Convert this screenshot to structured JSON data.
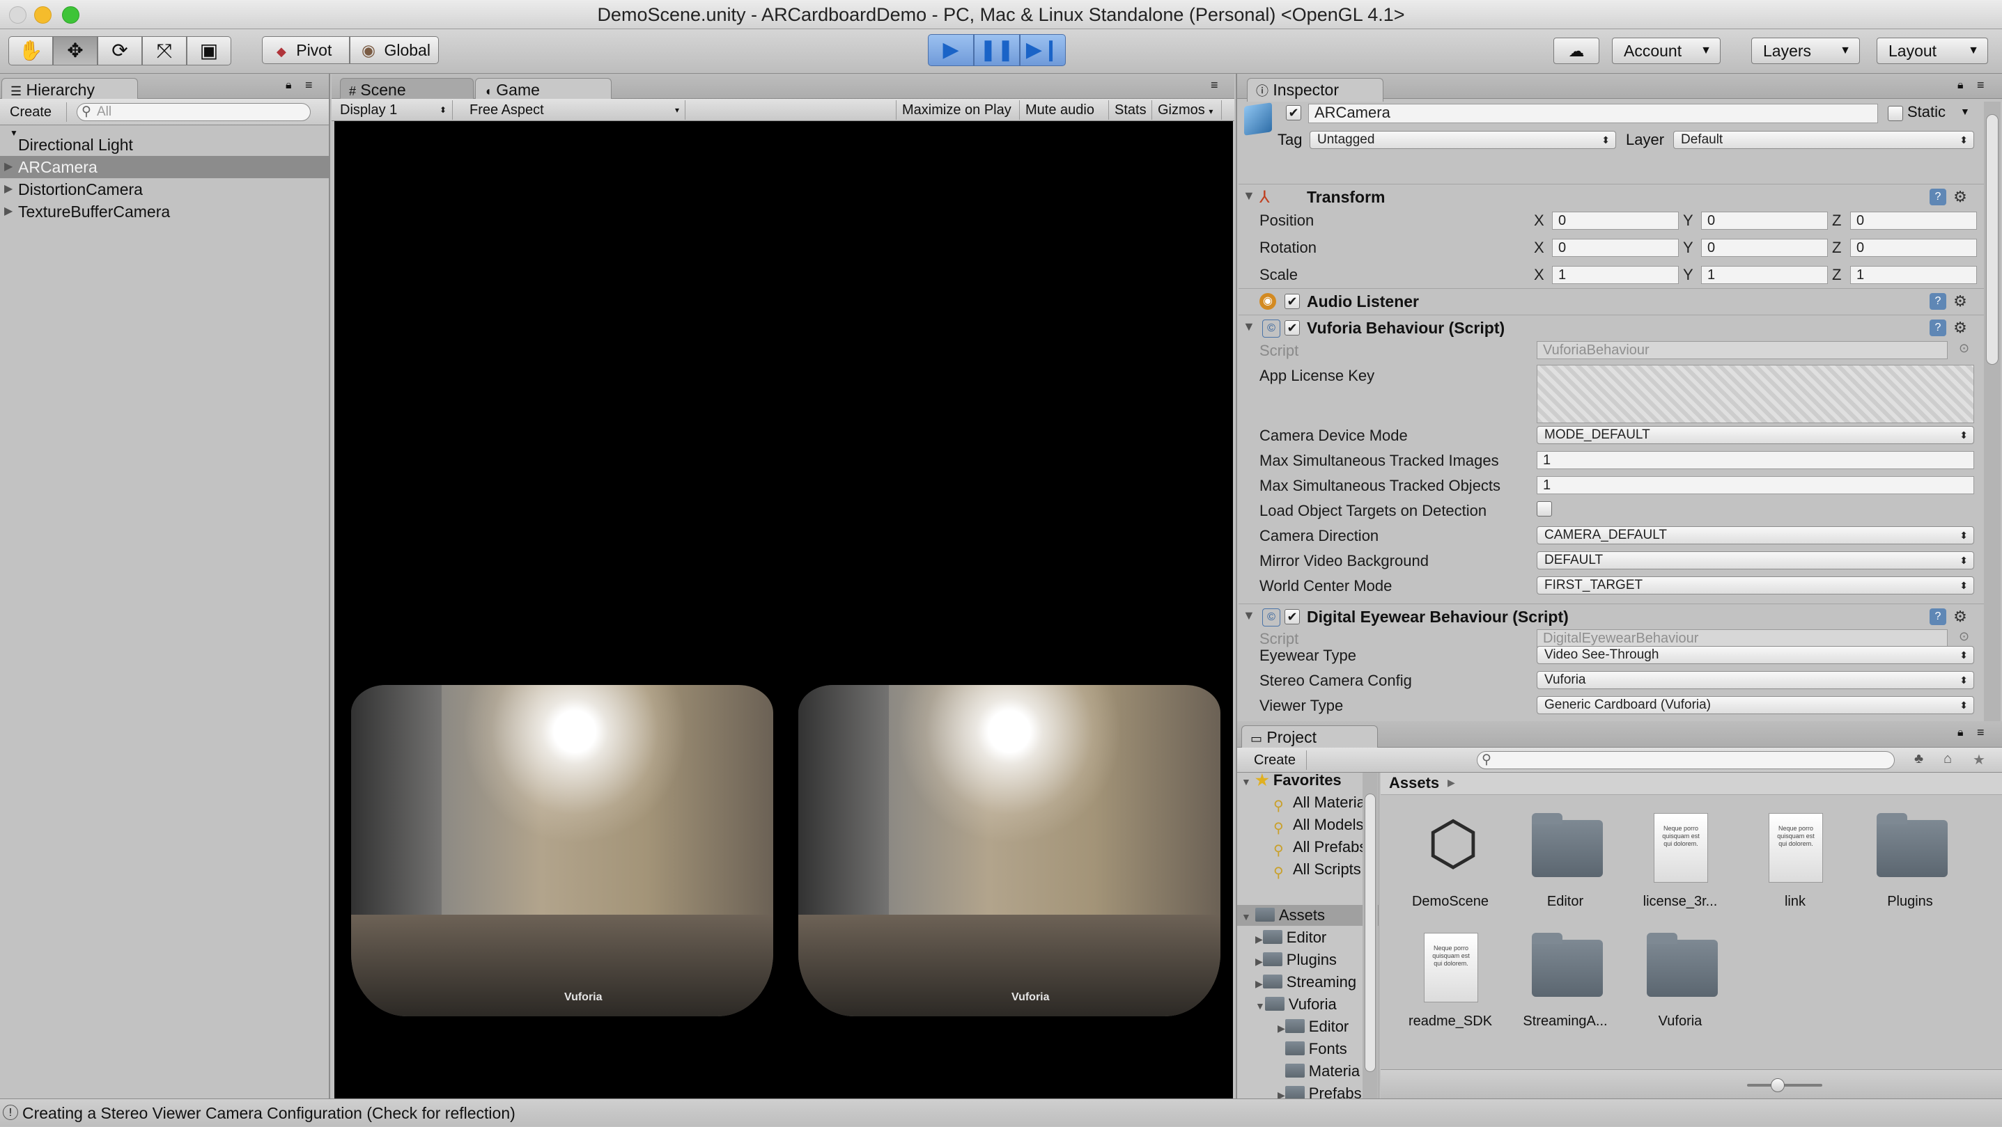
{
  "window": {
    "title": "DemoScene.unity - ARCardboardDemo - PC, Mac & Linux Standalone (Personal) <OpenGL 4.1>"
  },
  "toolbar": {
    "tools": [
      "hand-icon",
      "move-icon",
      "rotate-icon",
      "scale-icon",
      "rect-tool-icon"
    ],
    "pivot_label": "Pivot",
    "global_label": "Global",
    "account_label": "Account",
    "layers_label": "Layers",
    "layout_label": "Layout"
  },
  "hierarchy": {
    "tab_label": "Hierarchy",
    "create_label": "Create",
    "search_placeholder": "All",
    "items": [
      {
        "label": "Directional Light",
        "selected": false,
        "expandable": false
      },
      {
        "label": "ARCamera",
        "selected": true,
        "expandable": true
      },
      {
        "label": "DistortionCamera",
        "selected": false,
        "expandable": true
      },
      {
        "label": "TextureBufferCamera",
        "selected": false,
        "expandable": true
      }
    ]
  },
  "scene_view": {
    "tabs": [
      {
        "label": "Scene"
      },
      {
        "label": "Game"
      }
    ],
    "display_label": "Display 1",
    "aspect_label": "Free Aspect",
    "toggles": [
      "Maximize on Play",
      "Mute audio",
      "Stats",
      "Gizmos"
    ],
    "watermark": "Vuforia"
  },
  "inspector": {
    "tab_label": "Inspector",
    "object_name": "ARCamera",
    "static_label": "Static",
    "tag_label": "Tag",
    "tag_value": "Untagged",
    "layer_label": "Layer",
    "layer_value": "Default",
    "transform": {
      "title": "Transform",
      "position_label": "Position",
      "rotation_label": "Rotation",
      "scale_label": "Scale",
      "position": [
        "0",
        "0",
        "0"
      ],
      "rotation": [
        "0",
        "0",
        "0"
      ],
      "scale": [
        "1",
        "1",
        "1"
      ]
    },
    "audio_listener_title": "Audio Listener",
    "vuforia": {
      "title": "Vuforia Behaviour (Script)",
      "script_label": "Script",
      "script_value": "VuforiaBehaviour",
      "license_label": "App License Key",
      "camera_mode_label": "Camera Device Mode",
      "camera_mode_value": "MODE_DEFAULT",
      "max_images_label": "Max Simultaneous Tracked Images",
      "max_images_value": "1",
      "max_objects_label": "Max Simultaneous Tracked Objects",
      "max_objects_value": "1",
      "load_targets_label": "Load Object Targets on Detection",
      "camera_direction_label": "Camera Direction",
      "camera_direction_value": "CAMERA_DEFAULT",
      "mirror_label": "Mirror Video Background",
      "mirror_value": "DEFAULT",
      "world_center_label": "World Center Mode",
      "world_center_value": "FIRST_TARGET"
    },
    "eyewear": {
      "title": "Digital Eyewear Behaviour (Script)",
      "script_label": "Script",
      "script_value": "DigitalEyewearBehaviour",
      "type_label": "Eyewear Type",
      "type_value": "Video See-Through",
      "stereo_label": "Stereo Camera Config",
      "stereo_value": "Vuforia",
      "viewer_label": "Viewer Type",
      "viewer_value": "Generic Cardboard (Vuforia)"
    }
  },
  "project": {
    "tab_label": "Project",
    "create_label": "Create",
    "favorites_label": "Favorites",
    "favorites": [
      "All Materia",
      "All Models",
      "All Prefabs",
      "All Scripts"
    ],
    "assets_label": "Assets",
    "tree": [
      {
        "label": "Editor",
        "indent": 1
      },
      {
        "label": "Plugins",
        "indent": 1
      },
      {
        "label": "Streaming",
        "indent": 1
      },
      {
        "label": "Vuforia",
        "indent": 1
      },
      {
        "label": "Editor",
        "indent": 2
      },
      {
        "label": "Fonts",
        "indent": 2
      },
      {
        "label": "Materia",
        "indent": 2
      },
      {
        "label": "Prefabs",
        "indent": 2
      }
    ],
    "breadcrumb": "Assets",
    "assets": [
      {
        "name": "DemoScene",
        "kind": "unity-scene-icon"
      },
      {
        "name": "Editor",
        "kind": "folder-icon"
      },
      {
        "name": "license_3r...",
        "kind": "document-icon"
      },
      {
        "name": "link",
        "kind": "document-icon"
      },
      {
        "name": "Plugins",
        "kind": "folder-icon"
      },
      {
        "name": "readme_SDK",
        "kind": "document-icon"
      },
      {
        "name": "StreamingA...",
        "kind": "folder-icon"
      },
      {
        "name": "Vuforia",
        "kind": "folder-icon"
      }
    ],
    "doc_preview_text": "Neque porro quisquam est qui dolorem."
  },
  "status": {
    "message": "Creating a Stereo Viewer Camera Configuration (Check for reflection)"
  }
}
